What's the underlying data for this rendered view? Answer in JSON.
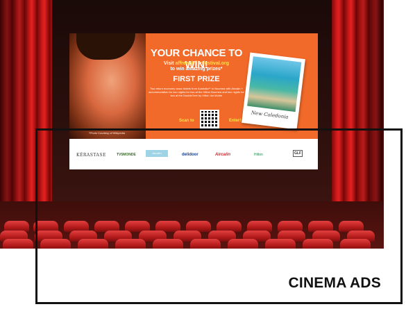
{
  "section": {
    "title": "CINEMA ADS"
  },
  "ad": {
    "headline": "YOUR CHANCE TO WIN!",
    "visit_prefix": "Visit ",
    "url": "affrenchfilmfestival.org",
    "visit_suffix": "to win amazing prizes*",
    "first_prize": "FIRST PRIZE",
    "prize_description": "Two return economy class tickets from Australia** to Noumea with Aircalin + accommodation for two nights for two at the Hilton Noumea and two nights for two at the DoubleTree by Hilton Ilot Maître",
    "scan_label": "Scan to",
    "enter_label": "Enter!",
    "photo_caption": "New Caledonia",
    "credit": "*Photo Courtesy of Wikipedia"
  },
  "sponsors": [
    "KÉRASTASE",
    "TV5MONDE",
    "Aircalin",
    "delidoor",
    "Aircalin",
    "Hilton",
    "GLF"
  ]
}
